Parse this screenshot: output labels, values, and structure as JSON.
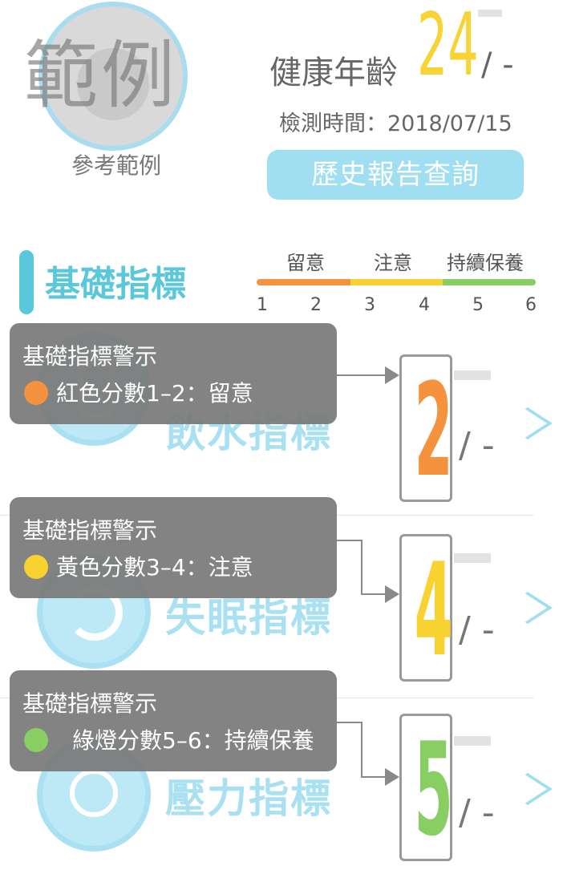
{
  "header": {
    "watermark": "範例",
    "avatar_caption": "參考範例",
    "age_label": "健康年齡",
    "age_value": "24",
    "age_suffix": "/ -",
    "check_time": "檢測時間：2018/07/15",
    "history_button": "歷史報告查詢"
  },
  "section": {
    "title": "基礎指標",
    "legend": [
      "留意",
      "注意",
      "持續保養"
    ],
    "scale_ticks": [
      "1",
      "2",
      "3",
      "4",
      "5",
      "6"
    ],
    "colors": {
      "orange": "#f5923e",
      "yellow": "#f8d230",
      "green": "#88ce62",
      "accent": "#5bc7db"
    }
  },
  "indicators": [
    {
      "name": "飲水指標",
      "icon": "cup-icon",
      "score": "2",
      "suffix": "/ -",
      "color": "#f5923e"
    },
    {
      "name": "失眠指標",
      "icon": "moon-icon",
      "score": "4",
      "suffix": "/ -",
      "color": "#f8d230"
    },
    {
      "name": "壓力指標",
      "icon": "face-icon",
      "score": "5",
      "suffix": "/ -",
      "color": "#88ce62"
    }
  ],
  "tooltips": [
    {
      "title": "基礎指標警示",
      "text": "紅色分數1–2：留意",
      "dot_color": "#f5923e"
    },
    {
      "title": "基礎指標警示",
      "text": "黃色分數3–4：注意",
      "dot_color": "#f8d230"
    },
    {
      "title": "基礎指標警示",
      "text": "綠燈分數5–6：持續保養",
      "dot_color": "#88ce62"
    }
  ]
}
